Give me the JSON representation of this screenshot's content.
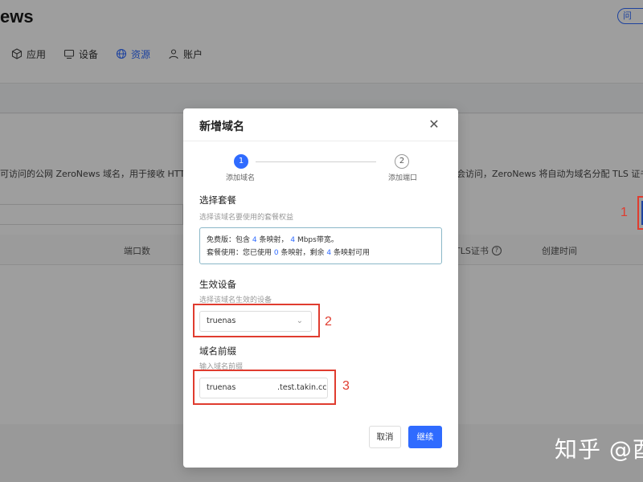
{
  "app": {
    "logo": "ews",
    "help_label": "问"
  },
  "nav": [
    {
      "icon": "cube-icon",
      "label": "应用"
    },
    {
      "icon": "monitor-icon",
      "label": "设备"
    },
    {
      "icon": "globe-icon",
      "label": "资源"
    },
    {
      "icon": "user-icon",
      "label": "账户"
    }
  ],
  "background": {
    "description_left": "可访问的公网 ZeroNews 域名，用于接收 HTTP ",
    "description_right": "会访问，ZeroNews 将自动为域名分配 TLS 证书。",
    "table_headers": {
      "ports": "端口数",
      "tls": "TLS证书",
      "created": "创建时间"
    },
    "tls_info_icon": "?"
  },
  "modal": {
    "title": "新增域名",
    "steps": [
      {
        "number": "1",
        "label": "添加域名"
      },
      {
        "number": "2",
        "label": "添加端口"
      }
    ],
    "plan": {
      "title": "选择套餐",
      "hint": "选择该域名要使用的套餐权益",
      "line1": {
        "prefix": "免费版：包含 ",
        "count": "4",
        "mid": " 条映射， ",
        "bw": "4",
        "suffix": " Mbps带宽。"
      },
      "line2": {
        "prefix": "套餐使用：您已使用 ",
        "used": "0",
        "mid": " 条映射，剩余 ",
        "remain": "4",
        "suffix": " 条映射可用"
      }
    },
    "device": {
      "title": "生效设备",
      "hint": "选择该域名生效的设备",
      "value": "truenas"
    },
    "prefix": {
      "title": "域名前缀",
      "hint": "输入域名前缀",
      "value": "truenas",
      "suffix": ".test.takin.cc"
    },
    "buttons": {
      "cancel": "取消",
      "next": "继续"
    }
  },
  "annotations": {
    "n1": "1",
    "n2": "2",
    "n3": "3",
    "color": "#e03c2f"
  },
  "watermark": "知乎 @酉"
}
